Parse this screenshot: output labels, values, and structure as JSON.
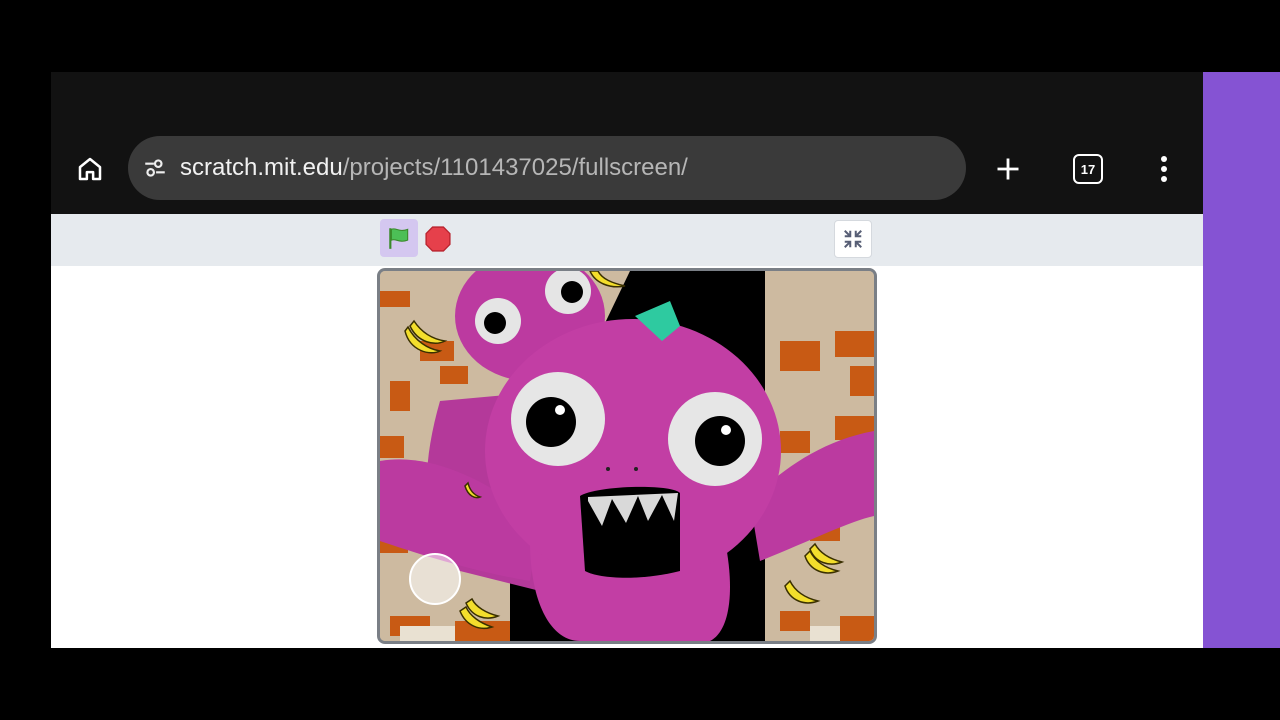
{
  "browser": {
    "url_host": "scratch.mit.edu",
    "url_path": "/projects/1101437025/fullscreen/",
    "tab_count": "17",
    "icons": {
      "home": "home-icon",
      "site_settings": "tune-icon",
      "new_tab": "plus-icon",
      "tabs": "tab-switcher-icon",
      "menu": "more-vert-icon"
    }
  },
  "scratch_player": {
    "controls": {
      "green_flag": "green-flag-icon",
      "stop": "stop-sign-icon",
      "exit_fullscreen": "exit-fullscreen-icon"
    },
    "stage": {
      "description_icon": "monster-artwork"
    }
  },
  "colors": {
    "browser_bar": "#121212",
    "omnibox": "#3a3a3a",
    "scratch_bar": "#e6eaee",
    "flag_highlight": "#d4c7f0",
    "side_strip": "#8553d3",
    "monster": "#c23ea4"
  }
}
